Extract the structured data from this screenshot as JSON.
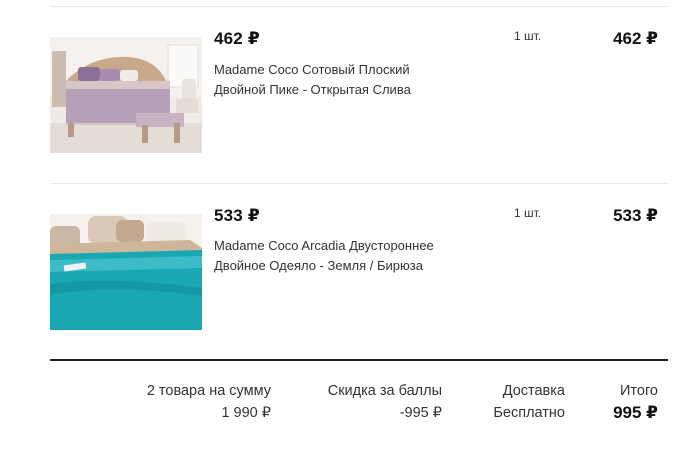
{
  "items": [
    {
      "price": "462 ₽",
      "title": "Madame Coco Сотовый Плоский Двойной Пике - Открытая Слива",
      "qty": "1 шт.",
      "total": "462 ₽",
      "image_icon": "bedroom-photo-plum"
    },
    {
      "price": "533 ₽",
      "title": "Madame Coco Arcadia Двустороннее Двойное Одеяло - Земля / Бирюза",
      "qty": "1 шт.",
      "total": "533 ₽",
      "image_icon": "bedroom-photo-turquoise"
    }
  ],
  "summary": {
    "goods_label": "2 товара на сумму",
    "goods_value": "1 990 ₽",
    "discount_label": "Скидка за баллы",
    "discount_value": "-995 ₽",
    "delivery_label": "Доставка",
    "delivery_value": "Бесплатно",
    "total_label": "Итого",
    "total_value": "995 ₽"
  },
  "colors": {
    "divider": "#e9e9e9",
    "divider_bold": "#1f1f1f",
    "text": "#222222"
  }
}
